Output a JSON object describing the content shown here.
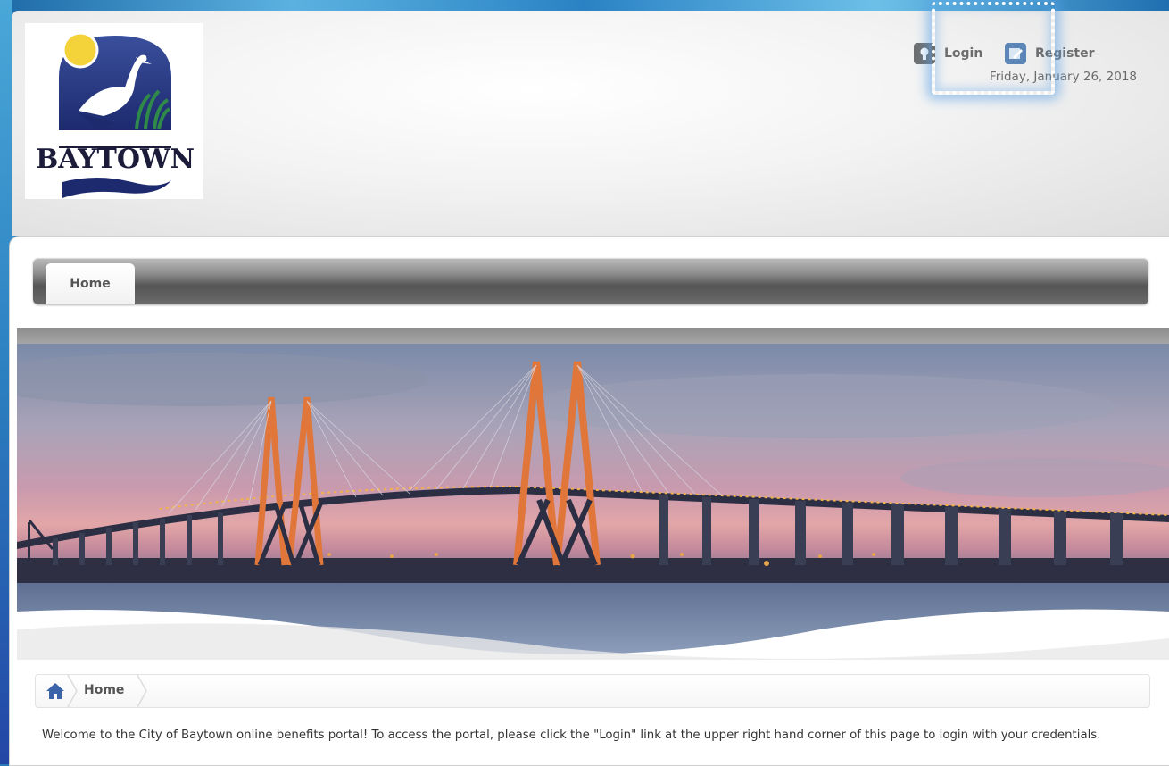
{
  "header": {
    "logo_text": "BAYTOWN",
    "util_links": [
      {
        "label": "Login",
        "icon": "lock-icon"
      },
      {
        "label": "Register",
        "icon": "edit-icon"
      }
    ],
    "date": "Friday, January 26, 2018"
  },
  "nav": {
    "tabs": [
      {
        "label": "Home"
      }
    ]
  },
  "breadcrumb": {
    "items": [
      {
        "label": "Home"
      }
    ]
  },
  "main": {
    "welcome_text": "Welcome to the City of Baytown online benefits portal!  To access the portal, please click the \"Login\" link at the upper right hand corner of this page to login with your credentials."
  },
  "colors": {
    "accent_blue": "#2a78b8",
    "nav_dark": "#555555",
    "text_grey": "#6d6d6d",
    "bridge_orange": "#e0763a"
  }
}
